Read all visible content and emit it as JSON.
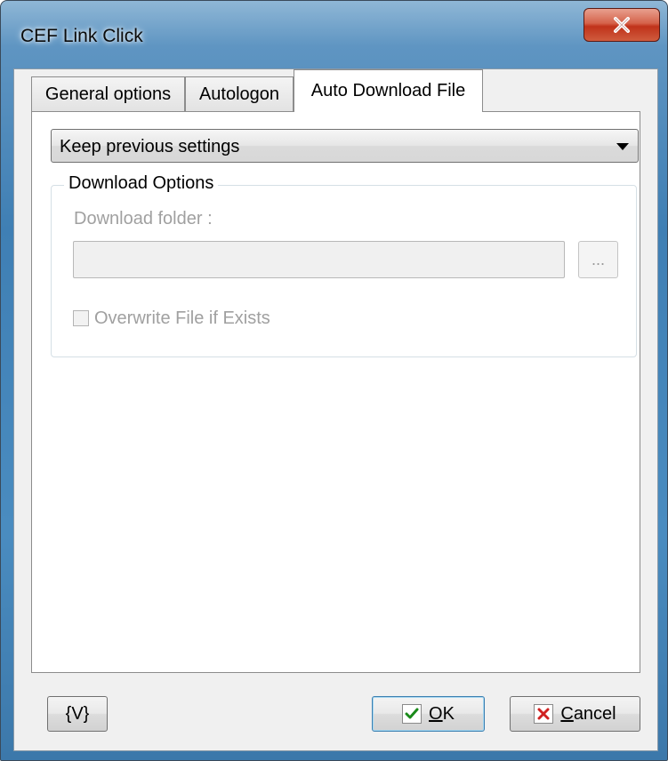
{
  "window": {
    "title": "CEF Link Click",
    "close_icon": "close-icon"
  },
  "tabs": [
    {
      "label": "General options",
      "active": false
    },
    {
      "label": "Autologon",
      "active": false
    },
    {
      "label": "Auto Download File",
      "active": true
    }
  ],
  "panel": {
    "mode_select": {
      "value": "Keep previous settings"
    },
    "download_options": {
      "legend": "Download Options",
      "folder_label": "Download folder :",
      "folder_value": "",
      "browse_label": "...",
      "overwrite_label": "Overwrite File if Exists",
      "overwrite_checked": false,
      "enabled": false
    }
  },
  "footer": {
    "variables_label": "{V}",
    "ok_label_first": "O",
    "ok_label_rest": "K",
    "cancel_label_first": "C",
    "cancel_label_rest": "ancel"
  },
  "colors": {
    "accent": "#3c7fb1",
    "ok_check": "#1a8a1a",
    "cancel_x": "#d02020",
    "close_button": "#c0321a"
  }
}
